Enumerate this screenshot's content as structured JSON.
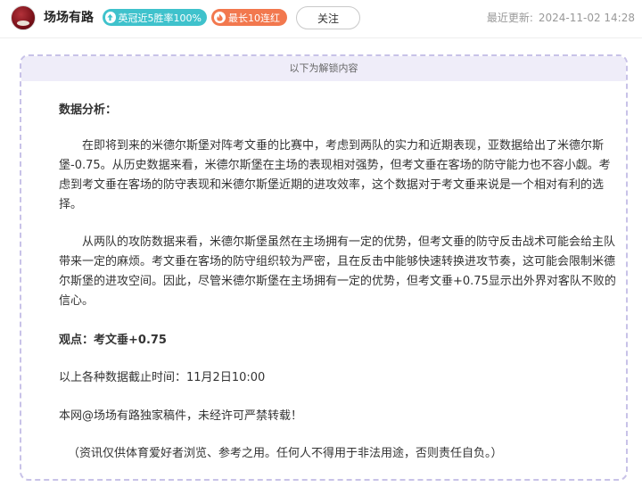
{
  "header": {
    "author": "场场有路",
    "badges": {
      "win_rate": "英冠近5胜率100%",
      "streak": "最长10连红"
    },
    "follow_label": "关注",
    "update_label": "最近更新:",
    "update_time": "2024-11-02 14:28"
  },
  "article": {
    "unlock_label": "以下为解锁内容",
    "heading": "数据分析：",
    "para1": "在即将到来的米德尔斯堡对阵考文垂的比赛中，考虑到两队的实力和近期表现，亚数据给出了米德尔斯堡-0.75。从历史数据来看，米德尔斯堡在主场的表现相对强势，但考文垂在客场的防守能力也不容小觑。考虑到考文垂在客场的防守表现和米德尔斯堡近期的进攻效率，这个数据对于考文垂来说是一个相对有利的选择。",
    "para2": "从两队的攻防数据来看，米德尔斯堡虽然在主场拥有一定的优势，但考文垂的防守反击战术可能会给主队带来一定的麻烦。考文垂在客场的防守组织较为严密，且在反击中能够快速转换进攻节奏，这可能会限制米德尔斯堡的进攻空间。因此，尽管米德尔斯堡在主场拥有一定的优势，但考文垂+0.75显示出外界对客队不败的信心。",
    "view": "观点：考文垂+0.75",
    "cutoff": "以上各种数据截止时间：11月2日10:00",
    "copyright": "本网@场场有路独家稿件，未经许可严禁转载！",
    "disclaimer": "（资讯仅供体育爱好者浏览、参考之用。任何人不得用于非法用途，否则责任自负。）"
  },
  "colors": {
    "win_badge": "#3fc2cc",
    "streak_badge": "#f2784e",
    "dashed_border": "#c8c2e8",
    "unlock_bar": "#efedf9"
  },
  "icons": {
    "win_badge": "arrow-up-icon",
    "streak_badge": "flame-icon"
  }
}
